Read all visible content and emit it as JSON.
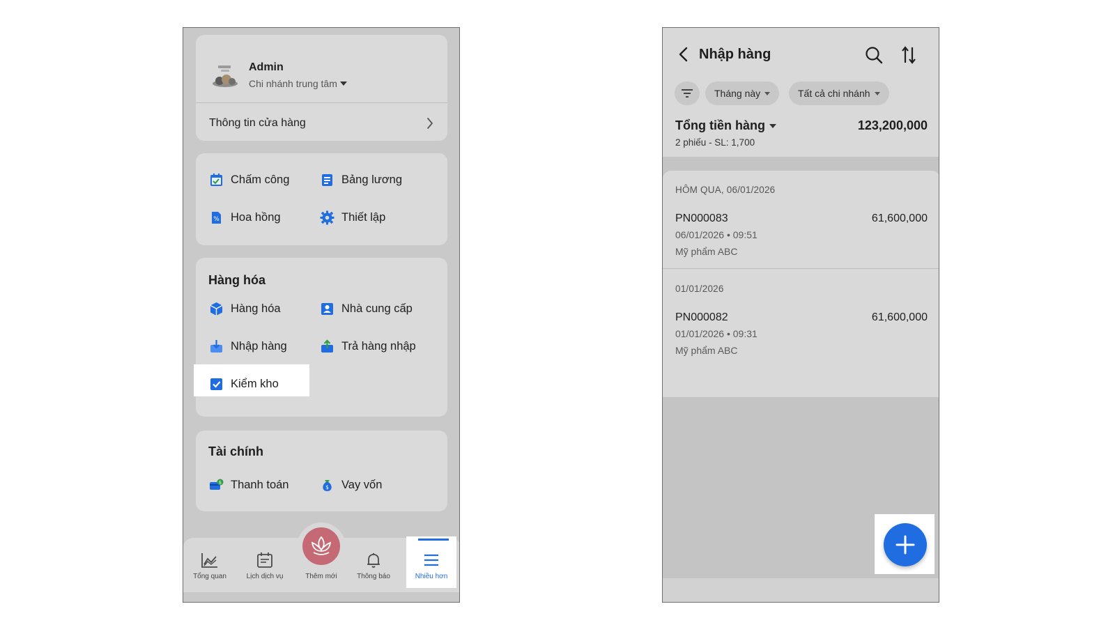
{
  "left_screen": {
    "profile": {
      "name": "Admin",
      "branch": "Chi nhánh trung tâm",
      "store_info": "Thông tin cửa hàng"
    },
    "hr_menu": [
      {
        "label": "Chấm công",
        "icon": "calendar-check-icon"
      },
      {
        "label": "Bảng lương",
        "icon": "payroll-sheet-icon"
      },
      {
        "label": "Hoa hồng",
        "icon": "commission-icon"
      },
      {
        "label": "Thiết lập",
        "icon": "gear-icon"
      }
    ],
    "goods_section": {
      "title": "Hàng hóa",
      "items": [
        {
          "label": "Hàng hóa",
          "icon": "box-icon"
        },
        {
          "label": "Nhà cung cấp",
          "icon": "supplier-icon"
        },
        {
          "label": "Nhập hàng",
          "icon": "import-icon",
          "highlighted": true
        },
        {
          "label": "Trả hàng nhập",
          "icon": "return-import-icon"
        },
        {
          "label": "Kiểm kho",
          "icon": "stock-check-icon"
        }
      ]
    },
    "finance_section": {
      "title": "Tài chính",
      "items": [
        {
          "label": "Thanh toán",
          "icon": "payment-icon"
        },
        {
          "label": "Vay vốn",
          "icon": "loan-icon"
        }
      ]
    },
    "bottom_nav": [
      {
        "label": "Tổng quan",
        "icon": "chart-icon"
      },
      {
        "label": "Lịch dịch vụ",
        "icon": "calendar-icon"
      },
      {
        "label": "Thêm mới",
        "icon": "lotus-icon"
      },
      {
        "label": "Thông báo",
        "icon": "bell-icon"
      },
      {
        "label": "Nhiều hơn",
        "icon": "menu-icon",
        "active": true
      }
    ],
    "colors": {
      "accent": "#1f6de0",
      "fab": "#c56a74"
    }
  },
  "right_screen": {
    "title": "Nhập hàng",
    "filters": {
      "period": "Tháng này",
      "branch": "Tất cả chi nhánh"
    },
    "summary": {
      "label": "Tổng tiền hàng",
      "value": "123,200,000",
      "sub": "2 phiếu - SL: 1,700"
    },
    "groups": [
      {
        "date": "HÔM QUA, 06/01/2026",
        "docs": [
          {
            "code": "PN000083",
            "amount": "61,600,000",
            "time": "06/01/2026 • 09:51",
            "supplier": "Mỹ phẩm ABC"
          }
        ]
      },
      {
        "date": "01/01/2026",
        "docs": [
          {
            "code": "PN000082",
            "amount": "61,600,000",
            "time": "01/01/2026 • 09:31",
            "supplier": "Mỹ phẩm ABC"
          }
        ]
      }
    ],
    "fab_icon": "plus-icon",
    "colors": {
      "fab": "#1f6de0"
    }
  }
}
